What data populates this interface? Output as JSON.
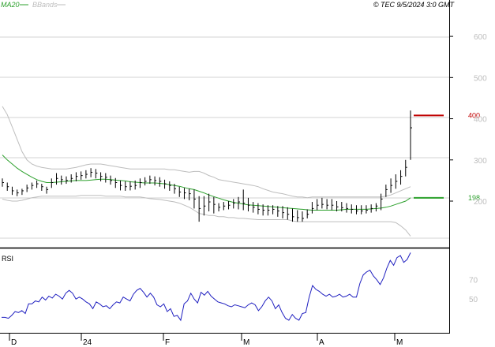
{
  "header": {
    "legend_ma": "MA20",
    "legend_bb": "BBands",
    "copyright": "© TEC 9/5/2024 3:0 GMT"
  },
  "colors": {
    "price": "#000000",
    "ma20": "#2ca02c",
    "bbands": "#bdbdbd",
    "rsi": "#1f1fc0",
    "level_line": "#c00000",
    "ma_marker": "#2ca02c",
    "gridline": "#d3d3d3"
  },
  "chart_data": [
    {
      "type": "line",
      "panel": "price",
      "ylim": [
        110,
        650
      ],
      "y_ticks": [
        200,
        300,
        400,
        500,
        600
      ],
      "y_tick_labels": [
        "200",
        "300",
        "400",
        "500",
        "600"
      ],
      "x_tick_labels": [
        "D",
        "24",
        "F",
        "M",
        "A",
        "M"
      ],
      "annotations": [
        {
          "label": "400",
          "value": 408,
          "color": "#c00000"
        },
        {
          "label": "198",
          "value": 208,
          "color": "#2ca02c"
        }
      ],
      "series": [
        {
          "kind": "ohlc",
          "highs": [
            255,
            245,
            235,
            228,
            230,
            240,
            245,
            250,
            242,
            235,
            255,
            268,
            262,
            260,
            265,
            270,
            272,
            275,
            280,
            278,
            270,
            268,
            262,
            256,
            250,
            248,
            248,
            250,
            255,
            258,
            262,
            260,
            258,
            252,
            248,
            242,
            235,
            232,
            230,
            228,
            212,
            212,
            218,
            210,
            195,
            198,
            200,
            205,
            210,
            228,
            208,
            198,
            195,
            192,
            190,
            190,
            188,
            188,
            185,
            182,
            178,
            175,
            180,
            198,
            205,
            208,
            205,
            205,
            200,
            198,
            195,
            192,
            190,
            190,
            190,
            192,
            195,
            218,
            240,
            255,
            265,
            275,
            300,
            420
          ],
          "lows": [
            235,
            225,
            215,
            212,
            215,
            222,
            228,
            232,
            225,
            218,
            232,
            240,
            240,
            242,
            245,
            248,
            252,
            255,
            258,
            255,
            248,
            245,
            240,
            232,
            226,
            225,
            226,
            228,
            232,
            238,
            242,
            238,
            235,
            230,
            225,
            218,
            210,
            205,
            202,
            182,
            150,
            165,
            175,
            170,
            175,
            178,
            180,
            182,
            180,
            178,
            175,
            172,
            168,
            165,
            165,
            168,
            162,
            158,
            155,
            150,
            150,
            150,
            158,
            170,
            178,
            182,
            180,
            178,
            175,
            175,
            172,
            170,
            168,
            168,
            170,
            172,
            175,
            178,
            210,
            220,
            230,
            240,
            260,
            300
          ],
          "closes": [
            245,
            235,
            225,
            220,
            225,
            232,
            238,
            242,
            235,
            228,
            245,
            255,
            252,
            250,
            255,
            260,
            262,
            265,
            270,
            268,
            260,
            258,
            250,
            245,
            238,
            235,
            236,
            238,
            245,
            248,
            252,
            250,
            248,
            242,
            238,
            230,
            222,
            220,
            218,
            205,
            182,
            188,
            198,
            192,
            185,
            188,
            190,
            195,
            198,
            195,
            190,
            185,
            180,
            178,
            178,
            180,
            176,
            172,
            168,
            162,
            160,
            158,
            168,
            182,
            190,
            192,
            190,
            190,
            186,
            184,
            182,
            180,
            176,
            176,
            178,
            182,
            188,
            205,
            228,
            238,
            248,
            260,
            282,
            378
          ]
        },
        {
          "name": "MA20",
          "values": [
            312,
            300,
            290,
            280,
            272,
            265,
            258,
            252,
            248,
            245,
            245,
            246,
            247,
            248,
            249,
            250,
            250,
            250,
            251,
            252,
            253,
            253,
            252,
            251,
            250,
            249,
            247,
            246,
            245,
            244,
            244,
            244,
            243,
            242,
            240,
            238,
            236,
            233,
            230,
            228,
            224,
            220,
            215,
            211,
            207,
            203,
            200,
            197,
            195,
            193,
            191,
            190,
            189,
            188,
            187,
            186,
            185,
            184,
            183,
            182,
            181,
            180,
            179,
            178,
            178,
            178,
            178,
            178,
            178,
            179,
            180,
            180,
            180,
            180,
            180,
            181,
            182,
            183,
            185,
            188,
            192,
            196,
            200,
            208
          ]
        },
        {
          "name": "BBands upper",
          "values": [
            430,
            410,
            380,
            350,
            320,
            300,
            290,
            285,
            282,
            280,
            278,
            278,
            278,
            278,
            280,
            282,
            285,
            288,
            290,
            290,
            290,
            288,
            286,
            284,
            282,
            280,
            278,
            278,
            278,
            278,
            278,
            278,
            278,
            278,
            276,
            276,
            274,
            272,
            270,
            272,
            272,
            268,
            262,
            258,
            252,
            250,
            248,
            246,
            244,
            242,
            240,
            238,
            235,
            230,
            226,
            222,
            220,
            218,
            215,
            212,
            210,
            210,
            208,
            210,
            210,
            210,
            210,
            210,
            210,
            210,
            210,
            210,
            210,
            210,
            210,
            210,
            210,
            210,
            212,
            215,
            220,
            225,
            230,
            235
          ]
        },
        {
          "name": "BBands lower",
          "values": [
            205,
            202,
            200,
            200,
            202,
            205,
            208,
            210,
            212,
            212,
            212,
            212,
            212,
            212,
            212,
            212,
            214,
            214,
            214,
            214,
            214,
            212,
            212,
            212,
            212,
            210,
            210,
            210,
            210,
            208,
            206,
            205,
            204,
            202,
            200,
            198,
            195,
            190,
            185,
            178,
            170,
            168,
            165,
            165,
            162,
            162,
            160,
            160,
            158,
            158,
            157,
            156,
            155,
            155,
            155,
            155,
            155,
            155,
            155,
            152,
            150,
            150,
            150,
            150,
            150,
            150,
            150,
            150,
            150,
            150,
            150,
            150,
            150,
            150,
            150,
            150,
            150,
            150,
            150,
            150,
            148,
            140,
            130,
            115
          ]
        }
      ]
    },
    {
      "type": "line",
      "panel": "rsi",
      "title": "RSI",
      "ylim": [
        15,
        100
      ],
      "y_ticks": [
        70,
        50
      ],
      "y_tick_labels": [
        "70",
        "50"
      ],
      "series": [
        {
          "name": "RSI",
          "values": [
            31,
            31,
            30,
            33,
            37,
            36,
            38,
            35,
            45,
            45,
            48,
            47,
            52,
            49,
            53,
            51,
            55,
            53,
            50,
            56,
            59,
            56,
            50,
            52,
            50,
            47,
            45,
            40,
            47,
            45,
            42,
            43,
            40,
            44,
            47,
            46,
            52,
            50,
            48,
            55,
            59,
            61,
            57,
            52,
            56,
            52,
            44,
            42,
            45,
            37,
            40,
            32,
            33,
            28,
            45,
            48,
            56,
            50,
            46,
            57,
            54,
            58,
            53,
            50,
            47,
            46,
            45,
            43,
            42,
            44,
            43,
            42,
            41,
            44,
            46,
            44,
            38,
            42,
            48,
            52,
            48,
            40,
            44,
            36,
            30,
            28,
            34,
            30,
            28,
            35,
            36,
            52,
            64,
            60,
            58,
            55,
            53,
            55,
            52,
            53,
            55,
            52,
            53,
            55,
            52,
            52,
            66,
            75,
            78,
            80,
            74,
            70,
            65,
            72,
            82,
            90,
            85,
            93,
            95,
            88,
            91,
            98
          ]
        }
      ]
    }
  ]
}
